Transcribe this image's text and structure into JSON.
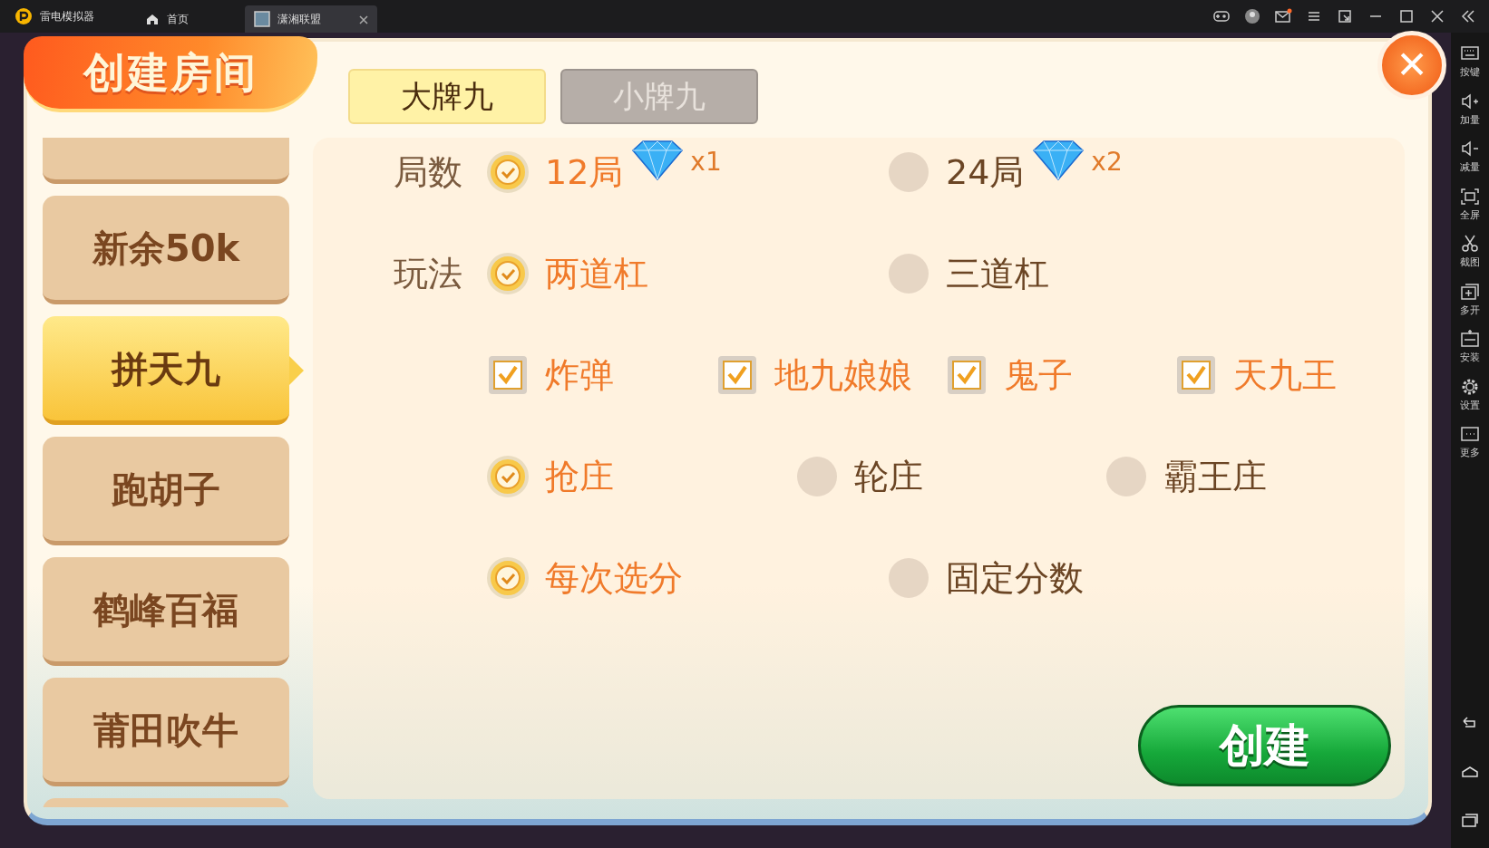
{
  "emulator": {
    "app_name": "雷电模拟器",
    "tabs": [
      {
        "label": "首页",
        "kind": "home",
        "selected": false
      },
      {
        "label": "潇湘联盟",
        "kind": "game",
        "selected": true
      }
    ],
    "sidebar": [
      {
        "label": "按键",
        "kind": "keyboard"
      },
      {
        "label": "加量",
        "kind": "volup"
      },
      {
        "label": "减量",
        "kind": "voldown"
      },
      {
        "label": "全屏",
        "kind": "fullscreen"
      },
      {
        "label": "截图",
        "kind": "scissors"
      },
      {
        "label": "多开",
        "kind": "multi"
      },
      {
        "label": "安装",
        "kind": "apk"
      },
      {
        "label": "设置",
        "kind": "gear"
      },
      {
        "label": "更多",
        "kind": "more"
      }
    ]
  },
  "dialog": {
    "title": "创建房间",
    "close": "✕",
    "tabs": [
      {
        "label": "大牌九",
        "selected": true
      },
      {
        "label": "小牌九",
        "selected": false
      }
    ],
    "games": [
      {
        "label": "新余50k",
        "selected": false
      },
      {
        "label": "拼天九",
        "selected": true
      },
      {
        "label": "跑胡子",
        "selected": false
      },
      {
        "label": "鹤峰百福",
        "selected": false
      },
      {
        "label": "莆田吹牛",
        "selected": false
      }
    ],
    "rows": [
      {
        "label": "局数",
        "options": [
          {
            "kind": "radio",
            "label": "12局",
            "selected": true,
            "cost": "x1"
          },
          {
            "kind": "radio",
            "label": "24局",
            "selected": false,
            "cost": "x2"
          }
        ]
      },
      {
        "label": "玩法",
        "options": [
          {
            "kind": "radio",
            "label": "两道杠",
            "selected": true
          },
          {
            "kind": "radio",
            "label": "三道杠",
            "selected": false
          }
        ]
      },
      {
        "options": [
          {
            "kind": "checkbox",
            "label": "炸弹",
            "checked": true
          },
          {
            "kind": "checkbox",
            "label": "地九娘娘",
            "checked": true
          },
          {
            "kind": "checkbox",
            "label": "鬼子",
            "checked": true
          },
          {
            "kind": "checkbox",
            "label": "天九王",
            "checked": true
          }
        ]
      },
      {
        "options": [
          {
            "kind": "radio",
            "label": "抢庄",
            "selected": true
          },
          {
            "kind": "radio",
            "label": "轮庄",
            "selected": false
          },
          {
            "kind": "radio",
            "label": "霸王庄",
            "selected": false
          }
        ]
      },
      {
        "options": [
          {
            "kind": "radio",
            "label": "每次选分",
            "selected": true
          },
          {
            "kind": "radio",
            "label": "固定分数",
            "selected": false
          }
        ]
      }
    ],
    "create_button": "创建"
  }
}
